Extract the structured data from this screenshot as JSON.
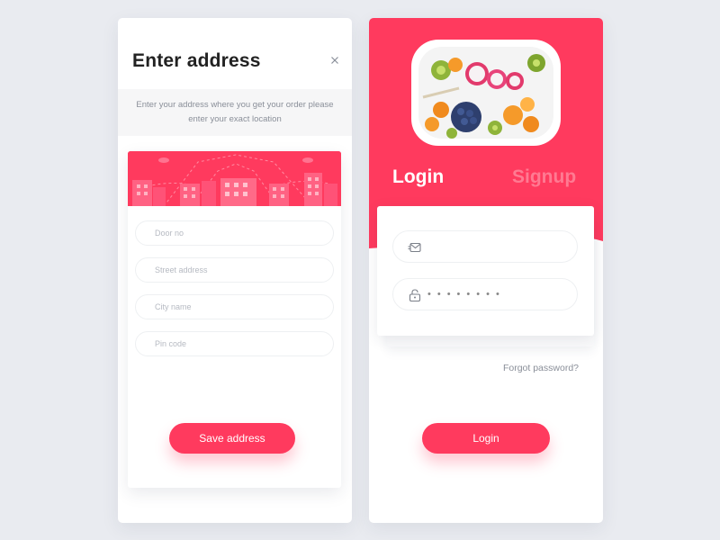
{
  "colors": {
    "accent": "#ff3a5e",
    "accent_light": "#ff7a92",
    "background": "#e9ebf0",
    "card": "#ffffff",
    "muted_text": "#8a8f99"
  },
  "address": {
    "title": "Enter address",
    "close_icon": "close-icon",
    "description": "Enter your address where you get your order please enter your exact location",
    "banner_image": "city-illustration",
    "fields": [
      {
        "placeholder": "Door no",
        "value": ""
      },
      {
        "placeholder": "Street address",
        "value": ""
      },
      {
        "placeholder": "City name",
        "value": ""
      },
      {
        "placeholder": "Pin code",
        "value": ""
      }
    ],
    "save_label": "Save address"
  },
  "login": {
    "hero_image": "fruit-platter",
    "tabs": [
      {
        "label": "Login",
        "active": true
      },
      {
        "label": "Signup",
        "active": false
      }
    ],
    "email": {
      "icon": "mail-icon",
      "value": ""
    },
    "password": {
      "icon": "lock-icon",
      "masked_value": "••••••••"
    },
    "forgot_label": "Forgot password?",
    "submit_label": "Login"
  }
}
